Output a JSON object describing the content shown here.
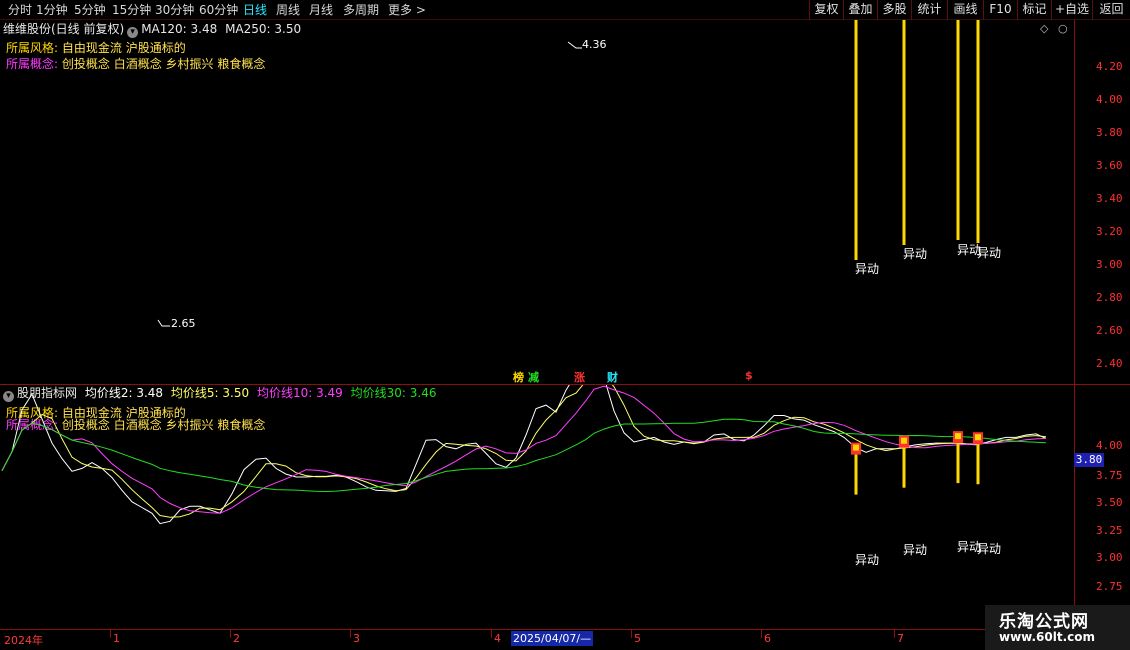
{
  "toolbar": {
    "periods": [
      "分时",
      "1分钟",
      "5分钟",
      "15分钟",
      "30分钟",
      "60分钟",
      "日线",
      "周线",
      "月线",
      "多周期",
      "更多 >"
    ],
    "active_period": "日线",
    "buttons": [
      "复权",
      "叠加",
      "多股",
      "统计",
      "画线",
      "F10",
      "标记",
      "+自选",
      "返回"
    ]
  },
  "main_panel": {
    "stock": "维维股份(日线 前复权)",
    "ma120": "MA120: 3.48",
    "ma250": "MA250: 3.50",
    "style_label": "所属风格:",
    "style_value": "自由现金流 沪股通标的",
    "concept_label": "所属概念:",
    "concept_value": "创投概念 白酒概念 乡村振兴 粮食概念",
    "high_label": "4.36",
    "low_label": "2.65",
    "y_ticks": [
      "4.20",
      "4.00",
      "3.80",
      "3.60",
      "3.40",
      "3.20",
      "3.00",
      "2.80",
      "2.60",
      "2.40"
    ],
    "event_marks": [
      "榜",
      "减",
      "涨",
      "财",
      "$"
    ],
    "signal_label": "异动"
  },
  "sub_panel": {
    "indicator": "股朋指标网",
    "line2": "均价线2: 3.48",
    "line5": "均价线5: 3.50",
    "line10": "均价线10: 3.49",
    "line30": "均价线30: 3.46",
    "style_label": "所属风格:",
    "style_value": "自由现金流 沪股通标的",
    "concept_label": "所属概念:",
    "concept_value": "创投概念 白酒概念 乡村振兴 粮食概念",
    "price_tag": "3.80",
    "y_ticks": [
      "4.00",
      "3.75",
      "3.50",
      "3.25",
      "3.00",
      "2.75"
    ],
    "signal_label": "异动"
  },
  "date_bar": {
    "labels": [
      "2024年",
      "1",
      "2",
      "3",
      "4",
      "5",
      "6",
      "7"
    ],
    "selected": "2025/04/07/—"
  },
  "watermark": {
    "title": "乐淘公式网",
    "url": "www.60lt.com"
  },
  "colors": {
    "up": "#ff3030",
    "down": "#27e8ff",
    "ma_white": "#ffffff",
    "ma_yellow": "#ffff66",
    "ma_magenta": "#ff40ff",
    "ma_green": "#22dd22",
    "signal": "#ffd800"
  }
}
